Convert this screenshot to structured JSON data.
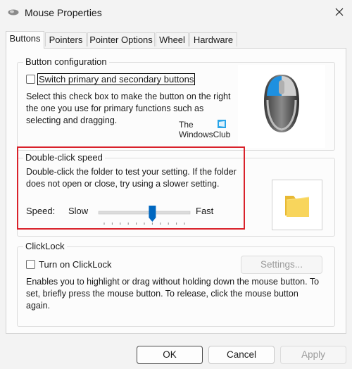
{
  "window": {
    "title": "Mouse Properties"
  },
  "tabs": [
    {
      "label": "Buttons",
      "active": true
    },
    {
      "label": "Pointers",
      "active": false
    },
    {
      "label": "Pointer Options",
      "active": false
    },
    {
      "label": "Wheel",
      "active": false
    },
    {
      "label": "Hardware",
      "active": false
    }
  ],
  "button_config": {
    "legend": "Button configuration",
    "switch_label": "Switch primary and secondary buttons",
    "switch_checked": false,
    "description": "Select this check box to make the button on the right the one you use for primary functions such as selecting and dragging.",
    "watermark_line1": "The",
    "watermark_line2": "WindowsClub"
  },
  "double_click": {
    "legend": "Double-click speed",
    "description": "Double-click the folder to test your setting. If the folder does not open or close, try using a slower setting.",
    "speed_label": "Speed:",
    "slow_label": "Slow",
    "fast_label": "Fast",
    "slider_ticks": 11,
    "slider_position": 0.6
  },
  "clicklock": {
    "legend": "ClickLock",
    "turn_on_label": "Turn on ClickLock",
    "turn_on_checked": false,
    "settings_label": "Settings...",
    "description": "Enables you to highlight or drag without holding down the mouse button. To set, briefly press the mouse button. To release, click the mouse button again."
  },
  "footer": {
    "ok_label": "OK",
    "cancel_label": "Cancel",
    "apply_label": "Apply"
  },
  "colors": {
    "highlight_border": "#d9222b",
    "slider_thumb": "#0067c0",
    "mouse_accent": "#1e90e0"
  }
}
